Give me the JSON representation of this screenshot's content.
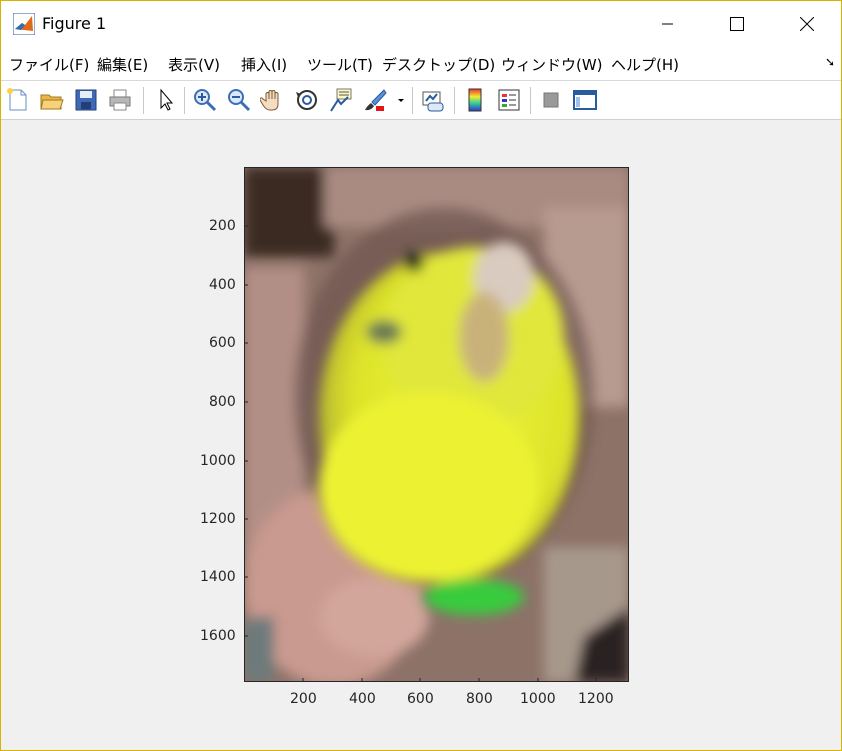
{
  "window": {
    "title": "Figure 1",
    "controls": [
      "minimize",
      "maximize",
      "close"
    ]
  },
  "menu": [
    {
      "label": "ファイル(F)"
    },
    {
      "label": "編集(E)"
    },
    {
      "label": "表示(V)"
    },
    {
      "label": "挿入(I)"
    },
    {
      "label": "ツール(T)"
    },
    {
      "label": "デスクトップ(D)"
    },
    {
      "label": "ウィンドウ(W)"
    },
    {
      "label": "ヘルプ(H)"
    }
  ],
  "toolbar": {
    "icons": [
      "new-figure-icon",
      "open-file-icon",
      "save-icon",
      "print-icon",
      "select-arrow-icon",
      "zoom-in-icon",
      "zoom-out-icon",
      "pan-hand-icon",
      "rotate-3d-icon",
      "data-cursor-icon",
      "brush-icon",
      "brush-dropdown-icon",
      "link-plot-icon",
      "colorbar-icon",
      "legend-icon",
      "hide-plot-tools-icon",
      "show-plot-tools-icon"
    ]
  },
  "axes": {
    "y_ticks": [
      "200",
      "400",
      "600",
      "800",
      "1000",
      "1200",
      "1400",
      "1600"
    ],
    "x_ticks": [
      "200",
      "400",
      "600",
      "800",
      "1000",
      "1200"
    ],
    "image_description_colors": {
      "bird": "#e8ea2a",
      "belly": "#3bd23c",
      "hand": "#c79a8e",
      "background": "#8a6a60"
    }
  }
}
